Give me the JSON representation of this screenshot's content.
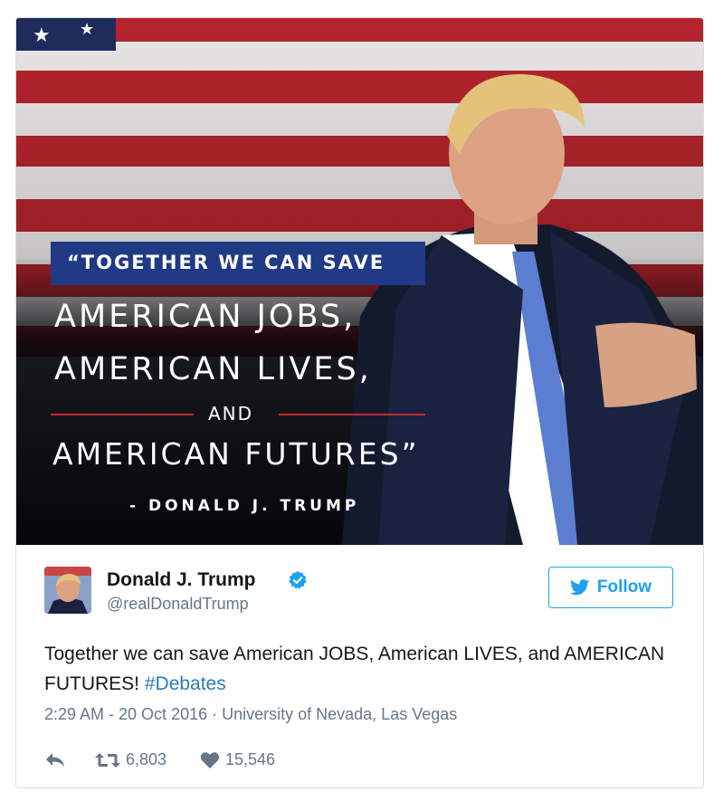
{
  "media": {
    "quote_line1": "“TOGETHER WE CAN SAVE",
    "quote_line2": "AMERICAN JOBS,",
    "quote_line3": "AMERICAN LIVES,",
    "quote_line4": "AND",
    "quote_line5": "AMERICAN FUTURES”",
    "attribution": "- DONALD J. TRUMP"
  },
  "author": {
    "name": "Donald J. Trump",
    "handle": "@realDonaldTrump",
    "verified_icon": "verified-badge-icon"
  },
  "follow_button": {
    "label": "Follow",
    "icon": "twitter-bird-icon"
  },
  "tweet": {
    "text": "Together we can save American JOBS, American LIVES, and AMERICAN FUTURES! ",
    "hashtag": "#Debates",
    "timestamp": "2:29 AM - 20 Oct 2016",
    "separator": " · ",
    "location": "University of Nevada, Las Vegas"
  },
  "actions": {
    "reply_icon": "reply-icon",
    "retweet_icon": "retweet-icon",
    "retweets": "6,803",
    "like_icon": "heart-icon",
    "likes": "15,546"
  },
  "colors": {
    "accent": "#1da1f2",
    "hashtag": "#2b7bb9",
    "banner": "#203a85",
    "flag_red": "#b4242c"
  }
}
